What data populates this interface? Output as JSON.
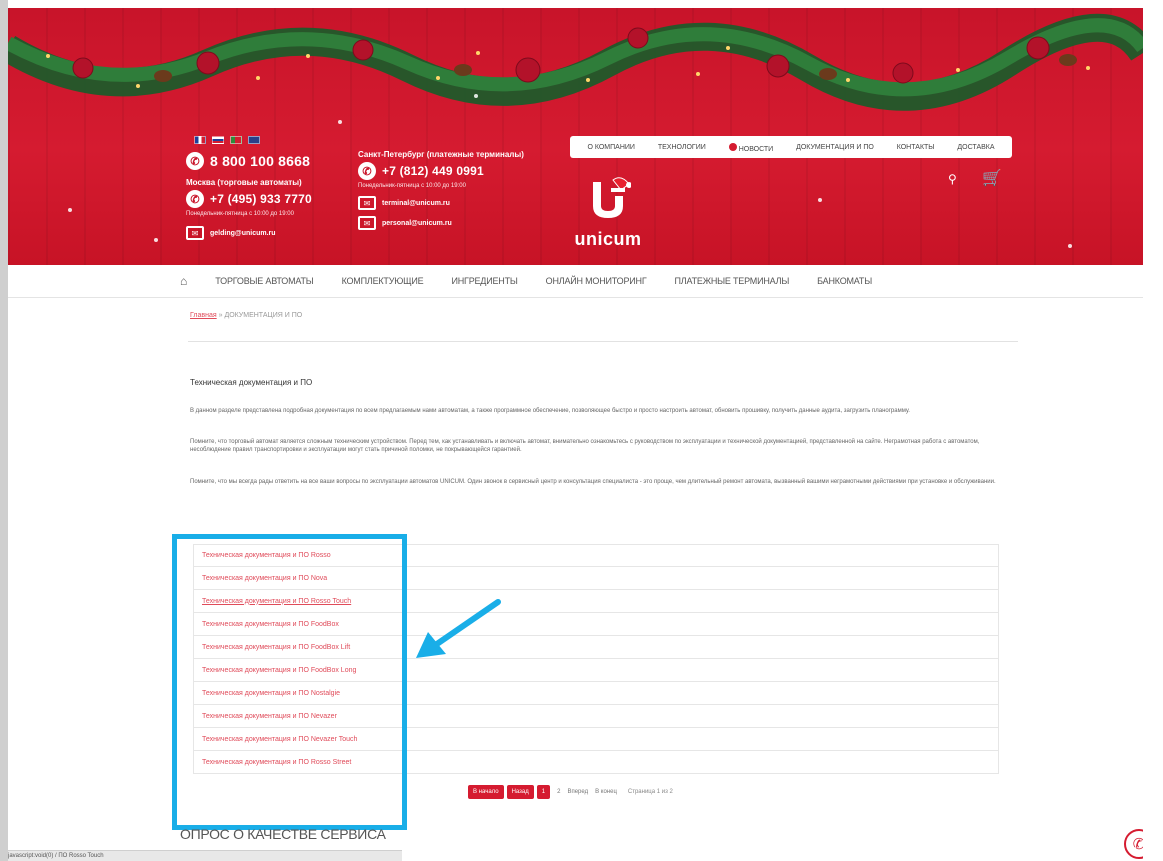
{
  "header": {
    "flags": [
      "fr",
      "ru",
      "pt",
      "en"
    ],
    "phone_main": "8 800 100 8668",
    "moscow_label": "Москва (торговые автоматы)",
    "moscow_phone": "+7 (495) 933 7770",
    "moscow_hours": "Понедельник-пятница с 10:00 до 19:00",
    "moscow_email": "gelding@unicum.ru",
    "spb_label": "Санкт-Петербург (платежные терминалы)",
    "spb_phone": "+7 (812) 449 0991",
    "spb_hours": "Понедельник-пятница с 10:00 до 19:00",
    "spb_email1": "terminal@unicum.ru",
    "spb_email2": "personal@unicum.ru",
    "logo_text": "unicum",
    "colors": {
      "brand_red": "#d51b30",
      "link_red": "#e04b5a",
      "highlight_blue": "#19aee8"
    }
  },
  "topnav": [
    "О КОМПАНИИ",
    "ТЕХНОЛОГИИ",
    "НОВОСТИ",
    "ДОКУМЕНТАЦИЯ И ПО",
    "КОНТАКТЫ",
    "ДОСТАВКА"
  ],
  "mainnav": [
    "ТОРГОВЫЕ АВТОМАТЫ",
    "КОМПЛЕКТУЮЩИЕ",
    "ИНГРЕДИЕНТЫ",
    "ОНЛАЙН МОНИТОРИНГ",
    "ПЛАТЕЖНЫЕ ТЕРМИНАЛЫ",
    "БАНКОМАТЫ"
  ],
  "breadcrumb": {
    "home": "Главная",
    "sep": " » ",
    "current": "ДОКУМЕНТАЦИЯ И ПО"
  },
  "content": {
    "title": "Техническая документация и ПО",
    "p1": "В данном разделе представлена подробная документация по всем предлагаемым нами автоматам, а также программное обеспечение, позволяющее быстро и просто настроить автомат, обновить прошивку, получить данные аудита, загрузить планограмму.",
    "p2": "Помните, что торговый автомат является сложным техническим устройством. Перед тем, как устанавливать и включать автомат, внимательно ознакомьтесь с руководством по эксплуатации и технической документацией, представленной на сайте. Неграмотная работа с автоматом, несоблюдение правил транспортировки и эксплуатации могут стать причиной поломки, не покрывающейся гарантией.",
    "p3": "Помните, что мы всегда рады ответить на все ваши вопросы по эксплуатации автоматов UNICUM. Один звонок в сервисный центр и консультация специалиста - это проще, чем длительный ремонт автомата, вызванный вашими неграмотными действиями при установке и обслуживании."
  },
  "docs": [
    "Техническая документация и ПО Rosso",
    "Техническая документация и ПО Nova",
    "Техническая документация и ПО Rosso Touch",
    "Техническая документация и ПО FoodBox",
    "Техническая документация и ПО FoodBox Lift",
    "Техническая документация и ПО FoodBox Long",
    "Техническая документация и ПО Nostalgie",
    "Техническая документация и ПО Nevazer",
    "Техническая документация и ПО Nevazer Touch",
    "Техническая документация и ПО Rosso Street"
  ],
  "pager": {
    "first": "В начало",
    "prev": "Назад",
    "page1": "1",
    "page2": "2",
    "next": "Вперед",
    "last": "В конец",
    "info": "Страница 1 из 2"
  },
  "survey_title": "ОПРОС О КАЧЕСТВЕ СЕРВИСА",
  "statusbar_text": "javascript:void(0) / ПО Rosso Touch"
}
